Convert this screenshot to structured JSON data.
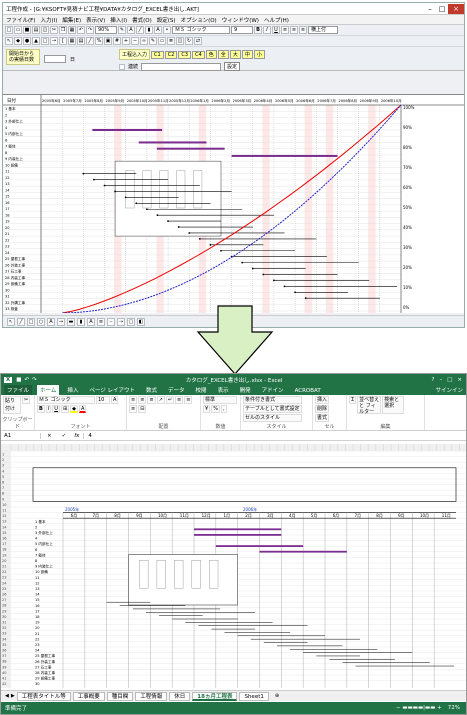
{
  "top_app": {
    "title": "工程作成 - [G:¥KSOFT¥見積ナビ工程¥DATA¥カタログ_EXCEL書き出し.AKT]",
    "menus": [
      "ファイル(F)",
      "入力(I)",
      "編集(E)",
      "表示(V)",
      "挿入(I)",
      "書式(O)",
      "設定(S)",
      "オプション(O)",
      "ウィンドウ(W)",
      "ヘルプ(H)"
    ],
    "zoom": "90%",
    "font_name": "ＭＳ ゴシック",
    "font_size": "9",
    "align_label": "横上付",
    "filter_label": "開始日からの実績日数",
    "filter_day_unit": "日",
    "kouki_label": "工程込入力",
    "kouki_buttons": [
      "C1",
      "C2",
      "C3",
      "C4",
      "色",
      "全",
      "大",
      "中",
      "小"
    ],
    "renzoku_label": "連続",
    "settei_button": "設定",
    "timeline_label": "日付",
    "months": [
      "2005年6月",
      "2005年7月",
      "2005年8月",
      "2005年9月",
      "2005年10月",
      "2005年11月",
      "2005年12月",
      "2006年1月",
      "2006年2月",
      "2006年3月",
      "2006年4月",
      "2006年5月",
      "2006年6月",
      "2006年7月",
      "2006年8月",
      "2006年9月",
      "2006年10月"
    ],
    "row_labels": [
      "1 基本",
      "2",
      "3 外部仕上",
      "4",
      "5 内部仕上",
      "6",
      "7 躯体",
      "8",
      "9 内装仕上",
      "10 設備",
      "11",
      "12",
      "13",
      "14",
      "15",
      "16",
      "17",
      "18",
      "19",
      "20",
      "21",
      "22",
      "23",
      "24",
      "25 屋根工事",
      "26 外装工事",
      "27 石工事",
      "28 内装工事",
      "29 設備工事",
      "30",
      "31",
      "32 外構工事",
      "33 検査"
    ],
    "percent_labels": [
      "100%",
      "90%",
      "80%",
      "70%",
      "60%",
      "50%",
      "40%",
      "30%",
      "20%",
      "10%",
      "0%"
    ]
  },
  "excel": {
    "title": "カタログ_EXCEL書き出し.xlsx - Excel",
    "tabs": [
      "ファイル",
      "ホーム",
      "挿入",
      "ページ レイアウト",
      "数式",
      "データ",
      "校閲",
      "表示",
      "開発",
      "アドイン",
      "ACROBAT"
    ],
    "signin": "サインイン",
    "ribbon": {
      "paste": "貼り付け",
      "clipboard": "クリップボード",
      "font_name": "ＭＳ ゴシック",
      "font_size": "10",
      "font_group": "フォント",
      "align_group": "配置",
      "number_group": "数値",
      "style_group": "スタイル",
      "cell_group": "セル",
      "edit_group": "編集",
      "cond_format": "条件付き書式",
      "table_format": "テーブルとして書式設定",
      "cell_style": "セルのスタイル",
      "insert": "挿入",
      "delete": "削除",
      "format": "書式",
      "sort": "並べ替えと フィルター",
      "find": "検索と 選択",
      "number_format": "標準"
    },
    "name_box": "A1",
    "formula_value": "4",
    "year_labels": [
      "2005年",
      "2006年"
    ],
    "months": [
      "6月",
      "7月",
      "8月",
      "9月",
      "10月",
      "11月",
      "12月",
      "1月",
      "2月",
      "3月",
      "4月",
      "5月",
      "6月",
      "7月",
      "8月",
      "9月",
      "10月",
      "11月"
    ],
    "sheets": [
      "工程表タイトル等",
      "工事概要",
      "種目欄",
      "工程情報",
      "休日",
      "18ヵ月工程表",
      "Sheet1"
    ],
    "active_sheet": "18ヵ月工程表",
    "status": "準備完了",
    "zoom": "72%"
  }
}
